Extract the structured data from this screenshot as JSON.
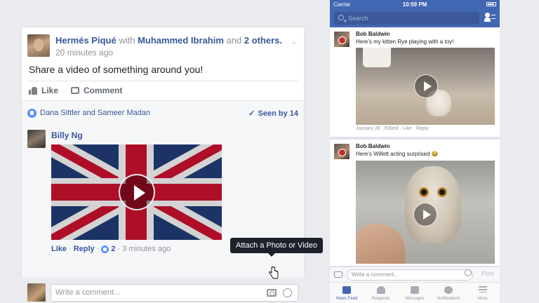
{
  "post": {
    "author": "Hermés Piqué",
    "with_word": "with",
    "tagged": "Muhammed Ibrahim",
    "and_word": "and",
    "others": "2 others.",
    "time": "20 minutes ago",
    "text": "Share a video of something around you!",
    "like_label": "Like",
    "comment_label": "Comment",
    "likers": "Dana Sittler and Sameer Madan",
    "seen": "Seen by 14"
  },
  "comment": {
    "author": "Billy Ng",
    "like_link": "Like",
    "reply_link": "Reply",
    "like_count": "2",
    "time": "3 minutes ago",
    "input_placeholder": "Write a comment...",
    "tooltip": "Attach a Photo or Video"
  },
  "phone": {
    "carrier": "Carrier",
    "time": "10:59 PM",
    "search_placeholder": "Search",
    "posts": [
      {
        "author": "Bob Baldwin",
        "caption": "Here's my kitten Rye playing with a toy!",
        "meta": "January 28 · Edited · Like · Reply"
      },
      {
        "author": "Bob Baldwin",
        "caption": "Here's Willett acting surprised 😂"
      }
    ],
    "composer_placeholder": "Write a comment...",
    "post_label": "Post",
    "tabs": [
      "News Feed",
      "Requests",
      "Messages",
      "Notifications",
      "More"
    ]
  },
  "colors": {
    "brand_blue": "#4267b2",
    "link_blue": "#365899",
    "background": "#e9ebee"
  }
}
